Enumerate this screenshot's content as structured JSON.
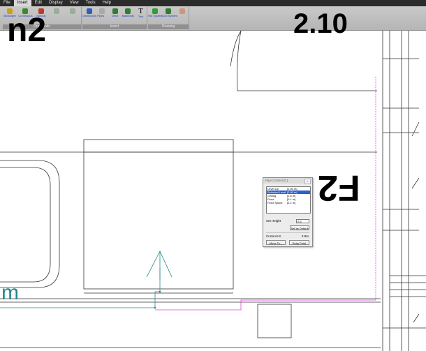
{
  "menu": [
    "File",
    "Insert",
    "Edit",
    "Display",
    "View",
    "Tools",
    "Help"
  ],
  "menu_active": "Insert",
  "ribbon": {
    "groups": [
      {
        "title": "Draw units",
        "buttons": [
          {
            "label": "Boxtarget",
            "icon": "boxtarget-icon",
            "enabled": true
          },
          {
            "label": "Continuous",
            "icon": "continuous-icon",
            "enabled": true
          },
          {
            "label": "Special",
            "icon": "special-icon",
            "enabled": true
          },
          {
            "label": "",
            "icon": "disabled-unit-icon",
            "enabled": false
          },
          {
            "label": "",
            "icon": "disabled-unit-icon",
            "enabled": false
          }
        ]
      },
      {
        "title": "Insert",
        "buttons": [
          {
            "label": "Distribution Pipes",
            "icon": "distribution-pipes-icon",
            "enabled": true
          },
          {
            "label": "",
            "icon": "disabled-insert-icon",
            "enabled": false
          },
          {
            "label": "Valve",
            "icon": "valve-icon",
            "enabled": true
          },
          {
            "label": "Manifolds",
            "icon": "manifolds-icon",
            "enabled": true
          },
          {
            "label": "Text",
            "icon": "text-icon",
            "enabled": true
          }
        ]
      },
      {
        "title": "Drawing",
        "buttons": [
          {
            "label": "Hot System",
            "icon": "hot-system-icon",
            "enabled": true
          },
          {
            "label": "Cold System",
            "icon": "cold-system-icon",
            "enabled": true
          },
          {
            "label": "",
            "icon": "disabled-drawing-icon",
            "enabled": false
          }
        ]
      }
    ]
  },
  "canvas": {
    "room_labels": {
      "top_left": "n2",
      "top_center": "2.10",
      "dialog_right": "F2",
      "bottom_left": "m"
    },
    "colors": {
      "pipe": "#1f8a8a",
      "guide": "#e040e0",
      "wall": "#333333"
    }
  },
  "dialog": {
    "title": "Pipe Control [C]",
    "close": "x",
    "rows": [
      {
        "key": "Level Up",
        "value": "[1.00 m]",
        "selected": false
      },
      {
        "key": "Selected Level",
        "value": "[2.80 m]",
        "selected": true
      },
      {
        "key": "Ceiling",
        "value": "[2.6 m]",
        "selected": false
      },
      {
        "key": "Floor",
        "value": "[0.1 m]",
        "selected": false
      },
      {
        "key": "Floor Space",
        "value": "[0.1 m]",
        "selected": false
      }
    ],
    "set_height_label": "Set Height",
    "set_height_value": "2.6",
    "set_as_default": "Set as Default",
    "current_ht_label": "Current Ht.",
    "current_ht_value": "2.8m",
    "move_to": "Move To...",
    "entry_point": "Entry Point"
  }
}
